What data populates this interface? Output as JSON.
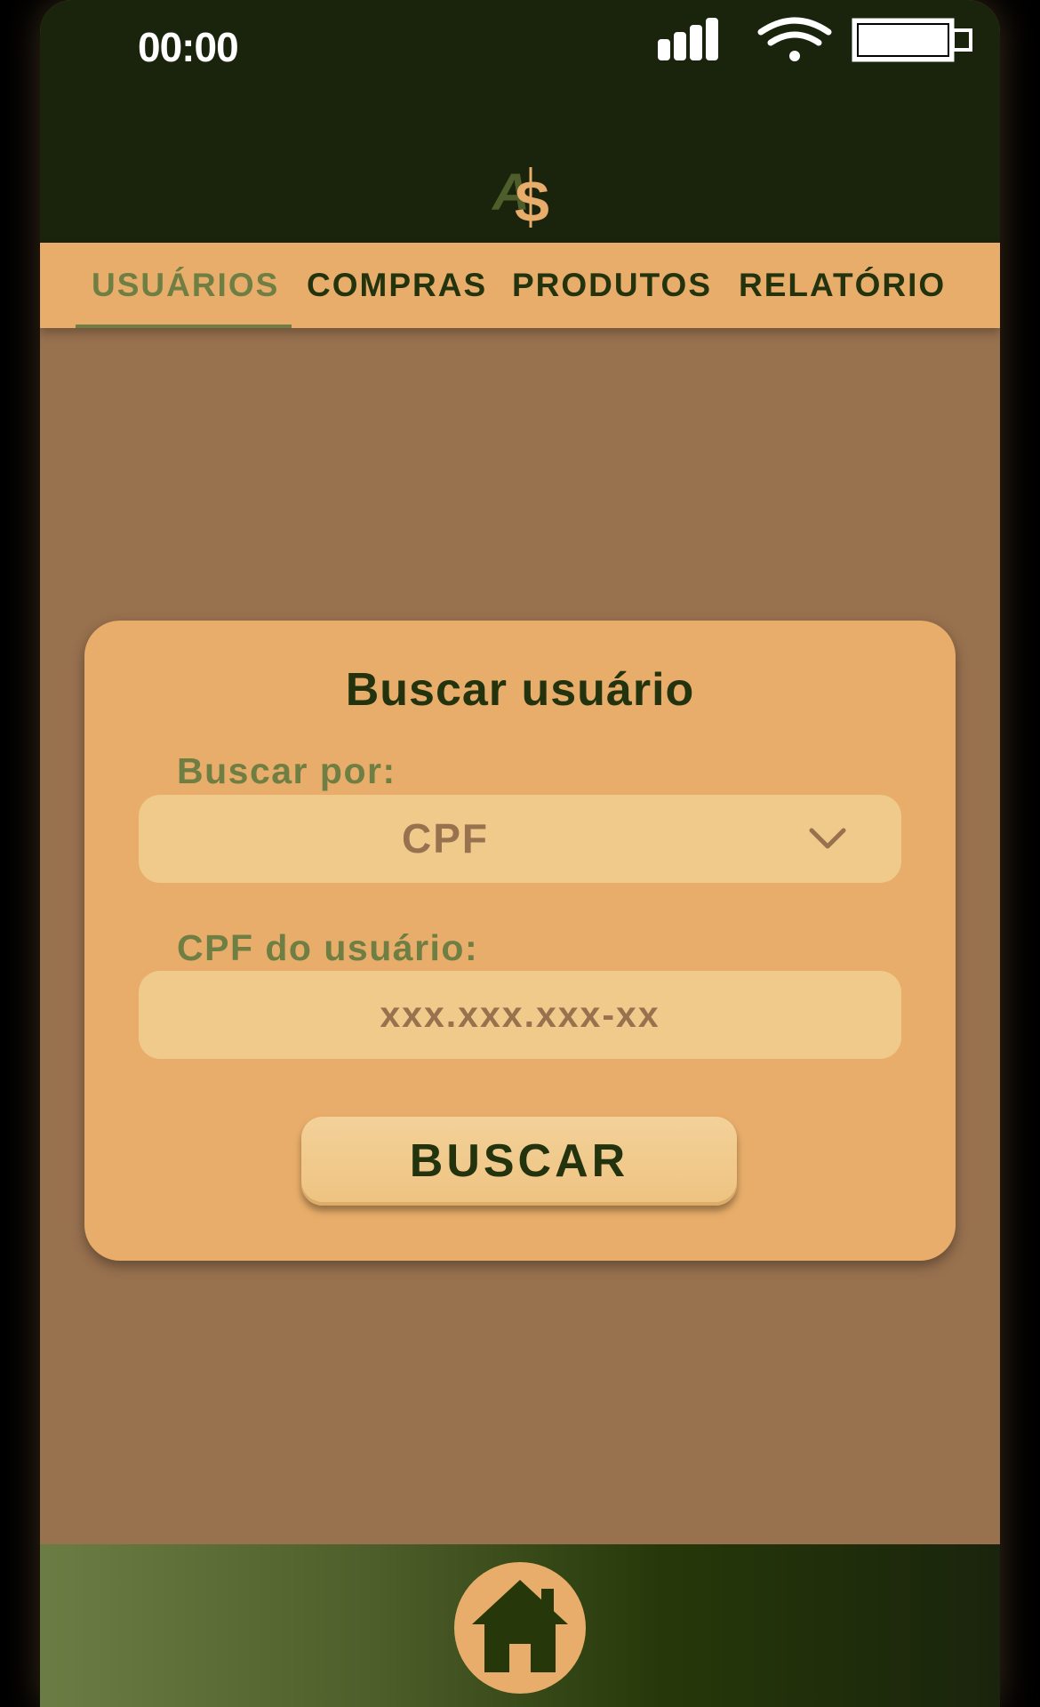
{
  "status_bar": {
    "time": "00:00"
  },
  "header": {
    "logo_letters": [
      "A",
      "S"
    ]
  },
  "tabs": [
    {
      "label": "USUÁRIOS",
      "active": true
    },
    {
      "label": "COMPRAS",
      "active": false
    },
    {
      "label": "PRODUTOS",
      "active": false
    },
    {
      "label": "RELATÓRIO",
      "active": false
    }
  ],
  "search_card": {
    "title": "Buscar usuário",
    "search_by_label": "Buscar por:",
    "search_by_value": "CPF",
    "cpf_label": "CPF do usuário:",
    "cpf_placeholder": "xxx.xxx.xxx-xx",
    "cpf_value": "",
    "button_label": "BUSCAR"
  },
  "footer": {
    "home_icon": "home-icon"
  },
  "colors": {
    "dark_green": "#1a240c",
    "text_green": "#23330d",
    "olive": "#6f7e42",
    "orange": "#e8ad6a",
    "light_orange": "#efca8b",
    "brown": "#98714f"
  }
}
